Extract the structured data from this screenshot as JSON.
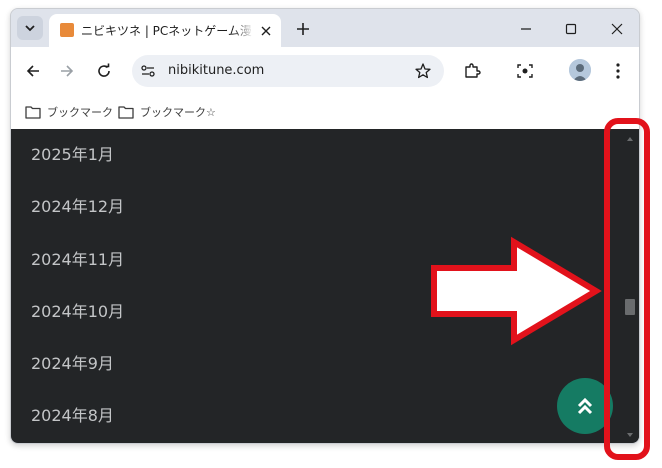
{
  "browser": {
    "tab": {
      "title": "ニビキツネ | PCネットゲーム漫画趣味",
      "favicon": "fox-favicon-icon"
    },
    "toolbar": {
      "url": "nibikitune.com",
      "icons": [
        "back-arrow-icon",
        "forward-arrow-icon",
        "reload-icon",
        "site-info-icon",
        "bookmark-star-icon",
        "extensions-icon",
        "screenshot-lens-icon",
        "profile-avatar",
        "more-menu-icon"
      ]
    },
    "bookmarks": [
      {
        "label": "ブックマーク"
      },
      {
        "label": "ブックマーク☆"
      }
    ]
  },
  "content": {
    "archive_months": [
      "2025年1月",
      "2024年12月",
      "2024年11月",
      "2024年10月",
      "2024年9月",
      "2024年8月"
    ],
    "back_to_top_icon": "double-chevron-up-icon"
  },
  "annotation": {
    "highlight_color": "#e2121b",
    "target": "scrollbar"
  },
  "colors": {
    "page_background": "#232527",
    "button_green": "#157b63",
    "chrome_frame": "#dfe3eb"
  }
}
